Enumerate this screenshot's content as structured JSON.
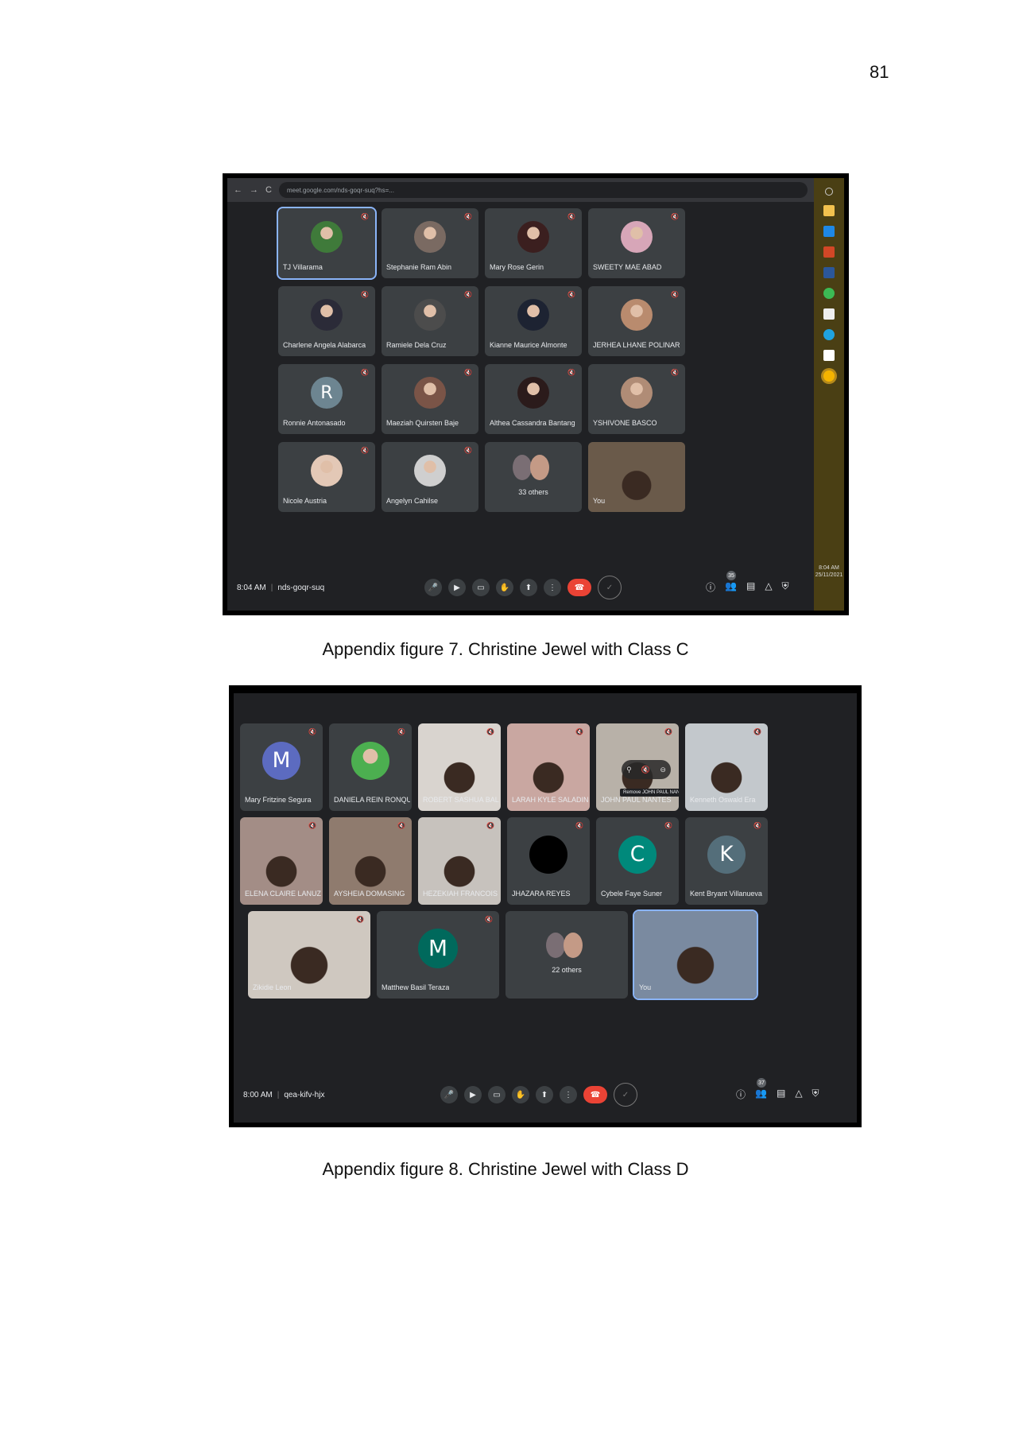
{
  "page_number": "81",
  "figure7": {
    "caption": "Appendix figure 7. Christine Jewel with Class C",
    "url": "meet.google.com/nds-goqr-suq?hs=...",
    "meeting_time": "8:04 AM",
    "meeting_code": "nds-goqr-suq",
    "sidebar_time": "8:04 AM",
    "sidebar_date": "25/11/2021",
    "participant_count": "35",
    "others_label": "33 others",
    "participants": [
      {
        "name": "TJ Villarama",
        "kind": "photo",
        "color": "#3f7a3a",
        "active": true
      },
      {
        "name": "Stephanie Ram Abin",
        "kind": "photo",
        "color": "#7a6a62"
      },
      {
        "name": "Mary Rose Gerin",
        "kind": "photo",
        "color": "#3b1f1f"
      },
      {
        "name": "SWEETY MAE ABAD",
        "kind": "photo",
        "color": "#d7a6b8"
      },
      {
        "name": "Charlene Angela Alabarca",
        "kind": "photo",
        "color": "#2b2b38"
      },
      {
        "name": "Ramiele Dela Cruz",
        "kind": "photo",
        "color": "#4c4c4c"
      },
      {
        "name": "Kianne Maurice Almonte",
        "kind": "photo",
        "color": "#1d2332"
      },
      {
        "name": "JERHEA LHANE POLINAR",
        "kind": "photo",
        "color": "#b98b6e"
      },
      {
        "name": "Ronnie Antonasado",
        "kind": "letter",
        "letter": "R",
        "color": "#6d8591"
      },
      {
        "name": "Maeziah Quirsten Baje",
        "kind": "photo",
        "color": "#7a5447"
      },
      {
        "name": "Althea Cassandra Bantang",
        "kind": "photo",
        "color": "#2b1b1b"
      },
      {
        "name": "YSHIVONE BASCO",
        "kind": "photo",
        "color": "#b08c76"
      },
      {
        "name": "Nicole Austria",
        "kind": "photo",
        "color": "#e3c8b6"
      },
      {
        "name": "Angelyn Cahilse",
        "kind": "photo",
        "color": "#cfcfcf"
      },
      {
        "name": "33 others",
        "kind": "others"
      },
      {
        "name": "You",
        "kind": "self",
        "color": "#6a5a4a"
      }
    ]
  },
  "figure8": {
    "caption": "Appendix figure 8. Christine Jewel with Class D",
    "meeting_time": "8:00 AM",
    "meeting_code": "qea-kifv-hjx",
    "participant_count": "37",
    "others_label": "22 others",
    "hover_tip": "Remove JOHN PAUL NANTES from the call",
    "participants": [
      {
        "name": "Mary Fritzine Segura",
        "kind": "letter",
        "letter": "M",
        "color": "#5c6bc0"
      },
      {
        "name": "DANIELA REIN RONQUIL...",
        "kind": "photo",
        "color": "#4caf50"
      },
      {
        "name": "ROBERT SASHUA BALL S...",
        "kind": "video",
        "color": "#d9d4cf"
      },
      {
        "name": "LARAH KYLE SALADINO",
        "kind": "video",
        "color": "#c9a7a1"
      },
      {
        "name": "JOHN PAUL NANTES",
        "kind": "video",
        "color": "#b8b1a8"
      },
      {
        "name": "Kenneth Oswald Era",
        "kind": "video",
        "color": "#c3c8cc"
      },
      {
        "name": "ELENA CLAIRE LANUZA",
        "kind": "video",
        "color": "#a38d86"
      },
      {
        "name": "AYSHEIA DOMASING",
        "kind": "video",
        "color": "#8f7b6e"
      },
      {
        "name": "HEZEKIAH FRANCOIS M...",
        "kind": "video",
        "color": "#c7c2bd"
      },
      {
        "name": "JHAZARA REYES",
        "kind": "letter",
        "letter": "",
        "color": "#000000"
      },
      {
        "name": "Cybele Faye Suner",
        "kind": "letter",
        "letter": "C",
        "color": "#00897b"
      },
      {
        "name": "Kent Bryant Villanueva",
        "kind": "letter",
        "letter": "K",
        "color": "#546e7a"
      },
      {
        "name": "Zikidie Leon",
        "kind": "video",
        "color": "#cfc8c0"
      },
      {
        "name": "Matthew Basil Teraza",
        "kind": "letter",
        "letter": "M",
        "color": "#00695c"
      },
      {
        "name": "22 others",
        "kind": "others"
      },
      {
        "name": "You",
        "kind": "self",
        "color": "#7a8aa0"
      }
    ]
  }
}
